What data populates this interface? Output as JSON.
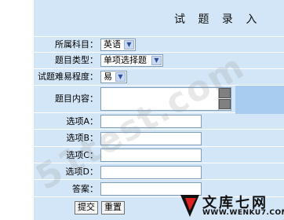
{
  "form": {
    "title": "试 题 录 入",
    "subject_label": "所属科目：",
    "subject_value": "英语",
    "type_label": "题目类型：",
    "type_value": "单项选择题",
    "difficulty_label": "试题难易程度：",
    "difficulty_value": "易",
    "content_label": "题目内容：",
    "option_a_label": "选项A：",
    "option_b_label": "选项B：",
    "option_c_label": "选项C：",
    "option_d_label": "选项D：",
    "answer_label": "答案：",
    "submit_label": "提交",
    "reset_label": "重置"
  },
  "watermark": {
    "text": "51test.com"
  },
  "brand": {
    "name": "文库七网",
    "url": "WWW.WENKU7.COM"
  },
  "colors": {
    "panel": "#d3e6f7",
    "highlight": "#a8ccf0",
    "brand_red": "#dd2222"
  }
}
